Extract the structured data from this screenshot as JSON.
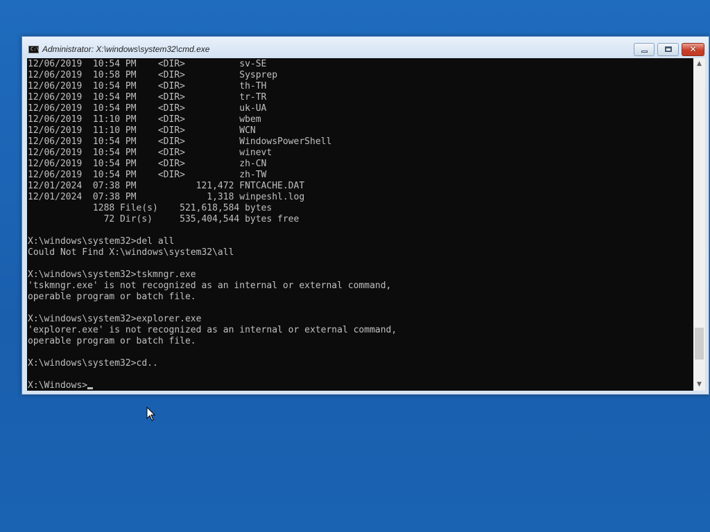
{
  "window": {
    "title": "Administrator: X:\\windows\\system32\\cmd.exe",
    "icon": "cmd-icon",
    "icon_text": "C:\\",
    "buttons": {
      "minimize": "minimize-icon",
      "maximize": "maximize-icon",
      "close": "close-icon",
      "close_glyph": "✕"
    }
  },
  "console": {
    "lines": [
      "12/06/2019  10:54 PM    <DIR>          sv-SE",
      "12/06/2019  10:58 PM    <DIR>          Sysprep",
      "12/06/2019  10:54 PM    <DIR>          th-TH",
      "12/06/2019  10:54 PM    <DIR>          tr-TR",
      "12/06/2019  10:54 PM    <DIR>          uk-UA",
      "12/06/2019  11:10 PM    <DIR>          wbem",
      "12/06/2019  11:10 PM    <DIR>          WCN",
      "12/06/2019  10:54 PM    <DIR>          WindowsPowerShell",
      "12/06/2019  10:54 PM    <DIR>          winevt",
      "12/06/2019  10:54 PM    <DIR>          zh-CN",
      "12/06/2019  10:54 PM    <DIR>          zh-TW",
      "12/01/2024  07:38 PM           121,472 FNTCACHE.DAT",
      "12/01/2024  07:38 PM             1,318 winpeshl.log",
      "            1288 File(s)    521,618,584 bytes",
      "              72 Dir(s)     535,404,544 bytes free",
      "",
      "X:\\windows\\system32>del all",
      "Could Not Find X:\\windows\\system32\\all",
      "",
      "X:\\windows\\system32>tskmngr.exe",
      "'tskmngr.exe' is not recognized as an internal or external command,",
      "operable program or batch file.",
      "",
      "X:\\windows\\system32>explorer.exe",
      "'explorer.exe' is not recognized as an internal or external command,",
      "operable program or batch file.",
      "",
      "X:\\windows\\system32>cd..",
      ""
    ],
    "prompt": "X:\\Windows>"
  },
  "scrollbar": {
    "up_arrow": "▲",
    "down_arrow": "▼",
    "position_fraction": 0.93
  },
  "colors": {
    "desktop": "#1f6bbd",
    "console_bg": "#0c0c0c",
    "console_fg": "#c0c0c0",
    "close_button": "#c8402b"
  }
}
